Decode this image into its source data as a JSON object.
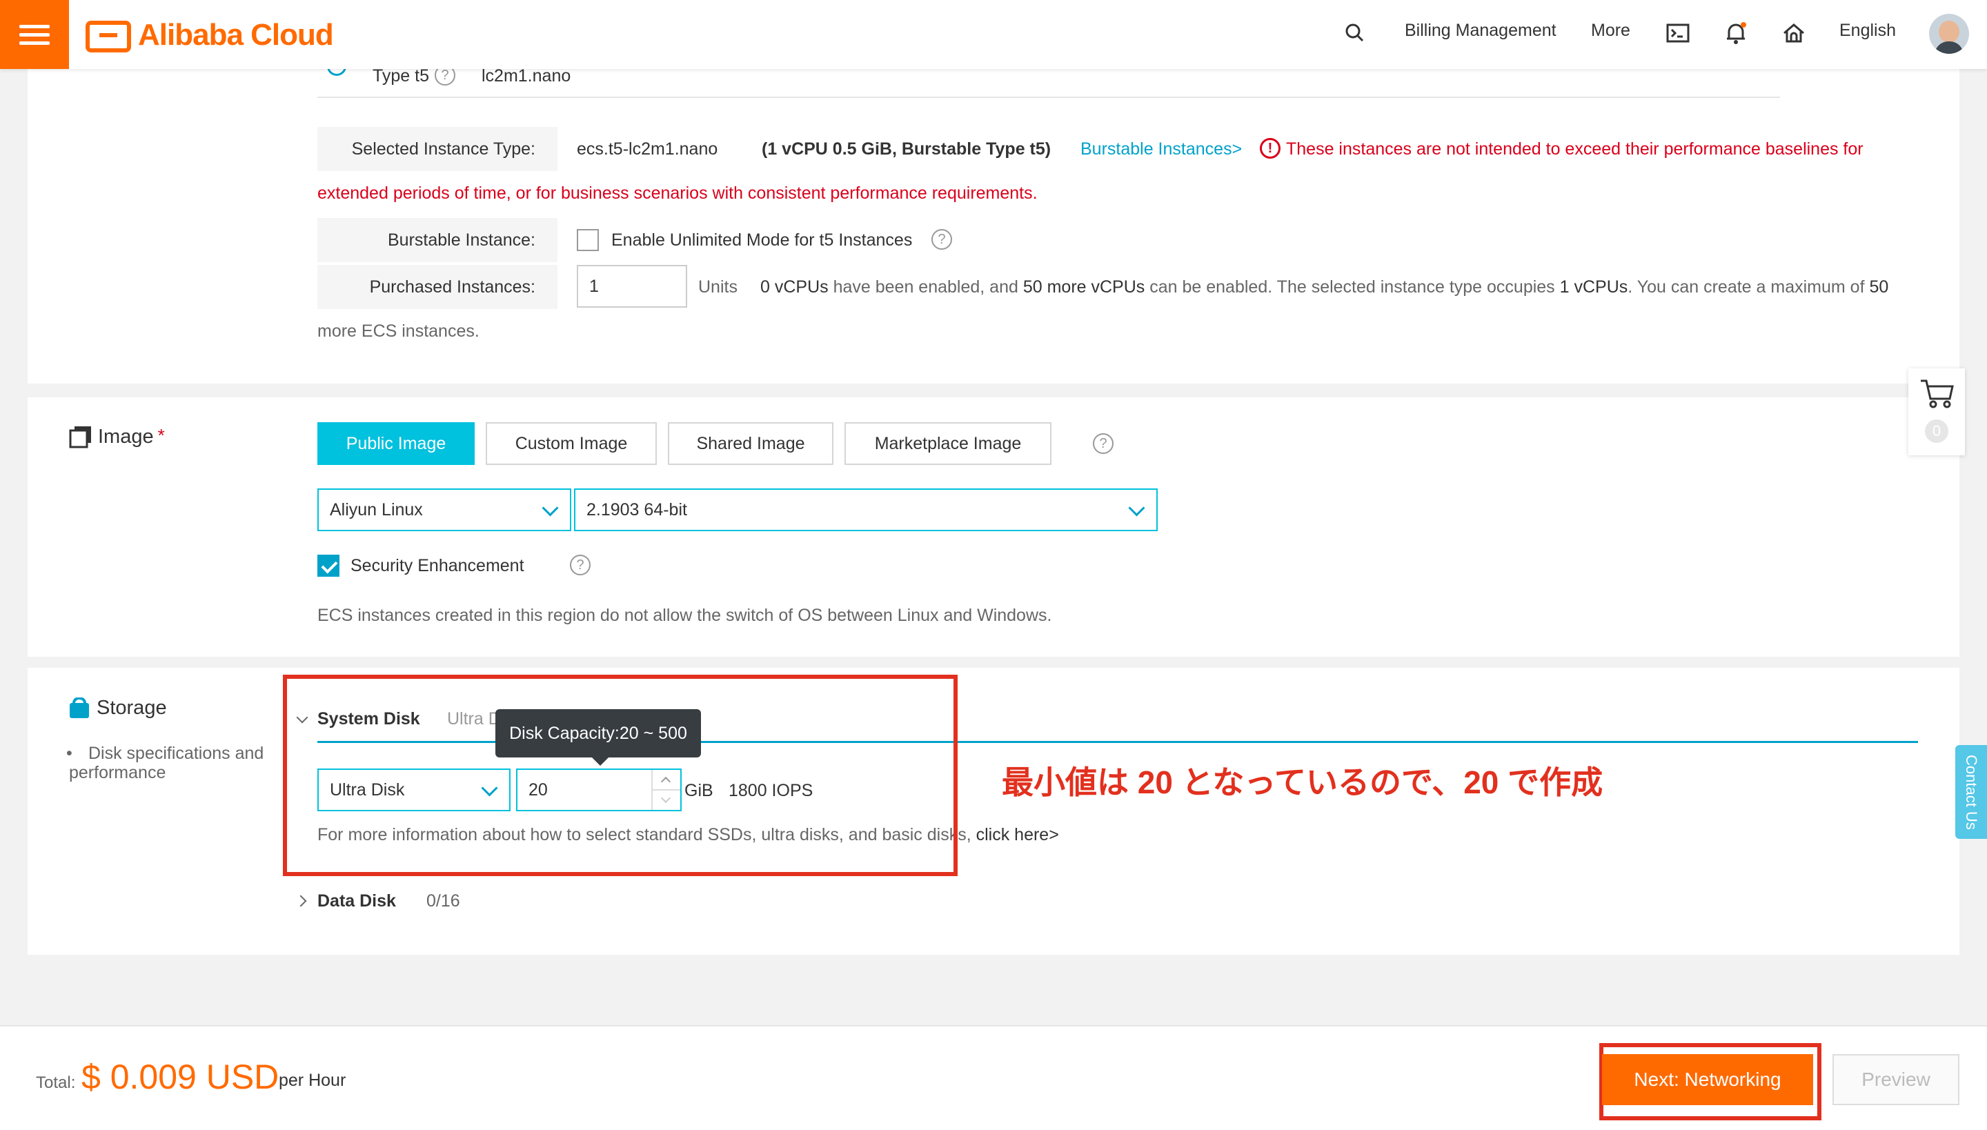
{
  "header": {
    "brand": "Alibaba Cloud",
    "billing": "Billing Management",
    "more": "More",
    "language": "English",
    "icons": [
      "menu-icon",
      "search-icon",
      "terminal-icon",
      "bell-icon",
      "home-icon",
      "avatar"
    ]
  },
  "instance": {
    "partial_row_label": "Type t5",
    "partial_row_value": "lc2m1.nano",
    "selected_label": "Selected Instance Type:",
    "selected_value": "ecs.t5-lc2m1.nano",
    "selected_spec": "(1 vCPU 0.5 GiB, Burstable Type t5)",
    "burstable_link": "Burstable Instances>",
    "warning_line1": "These instances are not intended to exceed their performance baselines for",
    "warning_line2": "extended periods of time, or for business scenarios with consistent performance requirements.",
    "burstable_label": "Burstable Instance:",
    "unlimited_mode": "Enable Unlimited Mode for t5 Instances",
    "purchased_label": "Purchased Instances:",
    "purchased_value": "1",
    "units": "Units",
    "quota": {
      "enabled": "0 vCPUs",
      "t1": " have been enabled, and ",
      "more": "50 more vCPUs",
      "t2": " can be enabled. The selected instance type occupies ",
      "occupies": "1 vCPUs",
      "t3": ". You can create a maximum of ",
      "max": "50",
      "line2": "more ECS instances."
    }
  },
  "image": {
    "title": "Image",
    "required_mark": "*",
    "tabs": [
      "Public Image",
      "Custom Image",
      "Shared Image",
      "Marketplace Image"
    ],
    "os": "Aliyun Linux",
    "version": "2.1903 64-bit",
    "security": "Security Enhancement",
    "note": "ECS instances created in this region do not allow the switch of OS between Linux and Windows."
  },
  "storage": {
    "title": "Storage",
    "subtitle_bullet": "•",
    "subtitle": "Disk specifications and performance",
    "system_disk": "System Disk",
    "system_disk_summary": "Ultra Disk   20 GiB",
    "tooltip": "Disk Capacity:20 ~ 500",
    "disk_type": "Ultra Disk",
    "disk_size": "20",
    "unit": "GiB",
    "iops": "1800 IOPS",
    "info_text": "For more information about how to select standard SSDs, ultra disks, and basic disks, ",
    "info_link": "click here>",
    "data_disk": "Data Disk",
    "data_disk_count": "0/16"
  },
  "annotation": "最小値は 20 となっているので、20 で作成",
  "cart_count": "0",
  "contact": "Contact Us",
  "footer": {
    "total_label": "Total:",
    "price": "$ 0.009 USD",
    "per": "per Hour",
    "next": "Next: Networking",
    "preview": "Preview"
  },
  "colors": {
    "accent": "#ff6a00",
    "primary": "#00c1de",
    "link": "#00a2ca",
    "warning": "#d9001b",
    "annotation": "#e2301e"
  }
}
